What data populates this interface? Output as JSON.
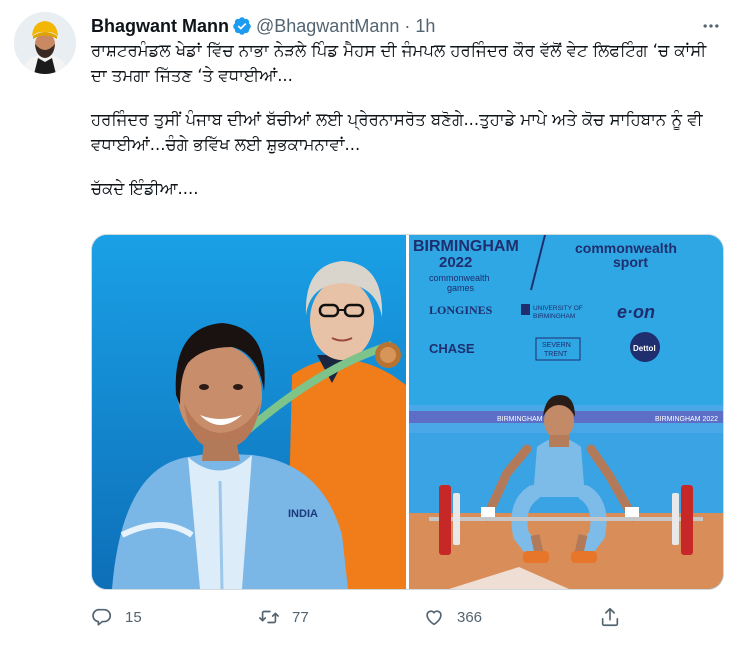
{
  "tweet": {
    "author_name": "Bhagwant Mann",
    "handle": "@BhagwantMann",
    "separator": "·",
    "time": "1h",
    "verified": true,
    "paragraphs": [
      "ਰਾਸ਼ਟਰਮੰਡਲ ਖੇਡਾਂ ਵਿੱਚ ਨਾਭਾ ਨੇੜਲੇ ਪਿੰਡ ਮੈਹਸ ਦੀ ਜੰਮਪਲ ਹਰਜਿੰਦਰ ਕੌਰ ਵੱਲੋਂ ਵੇਟ ਲਿਫਟਿੰਗ ‘ਚ ਕਾਂਸੀ ਦਾ ਤਮਗਾ ਜਿੱਤਣ ‘ਤੇ ਵਧਾਈਆਂ...",
      "ਹਰਜਿੰਦਰ ਤੁਸੀਂ ਪੰਜਾਬ ਦੀਆਂ ਬੱਚੀਆਂ ਲਈ ਪ੍ਰੇਰਨਾਸਰੋਤ ਬਣੋਗੇ...ਤੁਹਾਡੇ ਮਾਪੇ ਅਤੇ ਕੋਚ ਸਾਹਿਬਾਨ ਨੂੰ ਵੀ ਵਧਾਈਆਂ...ਚੰਗੇ ਭਵਿੱਖ ਲਈ ਸ਼ੁਭਕਾਮਨਾਵਾਂ...",
      "ਚੱਕਦੇ ਇੰਡੀਆ...."
    ]
  },
  "media": {
    "left_photo": {
      "jersey_text": "INDIA"
    },
    "right_photo": {
      "banner_city": "BIRMINGHAM",
      "banner_year": "2022",
      "banner_games_line1": "commonwealth",
      "banner_games_line2": "games",
      "cwg_sport_line1": "commonwealth",
      "cwg_sport_line2": "sport",
      "sponsors": [
        "LONGINES",
        "UNIVERSITY OF",
        "BIRMINGHAM",
        "e·on",
        "CHASE",
        "SEVERN",
        "TRENT",
        "Dettol"
      ],
      "bar_text_left": "BIRMINGHAM 2022",
      "bar_text_right": "BIRMINGHAM 2022"
    }
  },
  "actions": {
    "reply_count": "15",
    "retweet_count": "77",
    "like_count": "366"
  },
  "colors": {
    "text_primary": "#0f1419",
    "text_secondary": "#536471",
    "verified_blue": "#1d9bf0",
    "divider": "#cfd9de"
  },
  "icons": [
    "verified-badge-icon",
    "more-icon",
    "reply-icon",
    "retweet-icon",
    "like-icon",
    "share-icon"
  ]
}
